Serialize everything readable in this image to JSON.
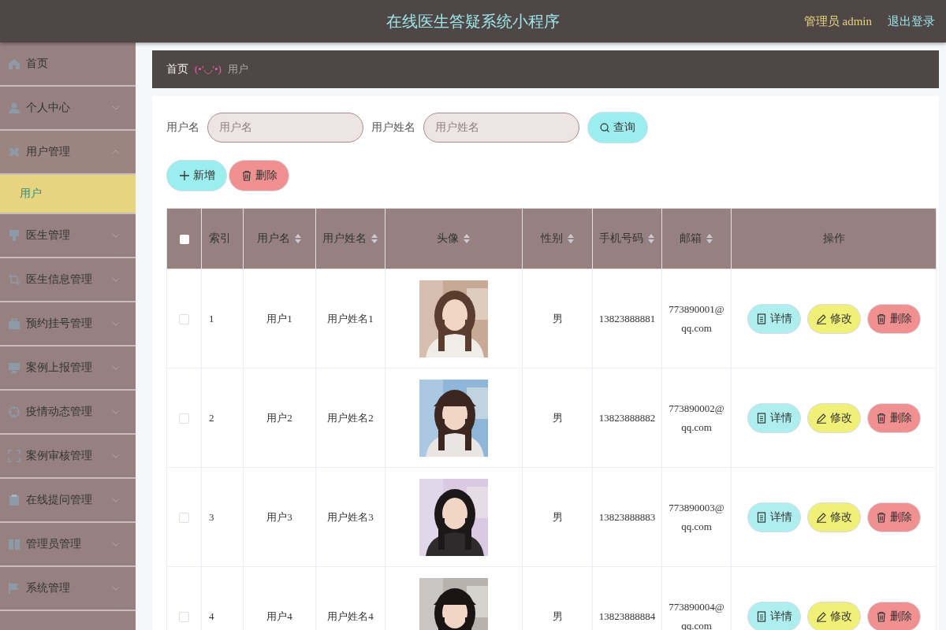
{
  "header": {
    "title": "在线医生答疑系统小程序",
    "user": "管理员 admin",
    "logout": "退出登录"
  },
  "sidebar": {
    "items": [
      {
        "label": "首页",
        "expandable": false,
        "selected": false
      },
      {
        "label": "个人中心",
        "expandable": true,
        "expanded": false,
        "selected": false
      },
      {
        "label": "用户管理",
        "expandable": true,
        "expanded": true,
        "selected": false,
        "children": [
          {
            "label": "用户",
            "selected": true
          }
        ]
      },
      {
        "label": "医生管理",
        "expandable": true,
        "expanded": false,
        "selected": false
      },
      {
        "label": "医生信息管理",
        "expandable": true,
        "expanded": false,
        "selected": false
      },
      {
        "label": "预约挂号管理",
        "expandable": true,
        "expanded": false,
        "selected": false
      },
      {
        "label": "案例上报管理",
        "expandable": true,
        "expanded": false,
        "selected": false
      },
      {
        "label": "疫情动态管理",
        "expandable": true,
        "expanded": false,
        "selected": false
      },
      {
        "label": "案例审核管理",
        "expandable": true,
        "expanded": false,
        "selected": false
      },
      {
        "label": "在线提问管理",
        "expandable": true,
        "expanded": false,
        "selected": false
      },
      {
        "label": "管理员管理",
        "expandable": true,
        "expanded": false,
        "selected": false
      },
      {
        "label": "系统管理",
        "expandable": true,
        "expanded": false,
        "selected": false
      }
    ]
  },
  "breadcrumb": {
    "home": "首页",
    "separator": "(•'◡'•)",
    "current": "用户"
  },
  "search": {
    "fields": [
      {
        "label": "用户名",
        "placeholder": "用户名"
      },
      {
        "label": "用户姓名",
        "placeholder": "用户姓名"
      }
    ],
    "button": "查询"
  },
  "actions": [
    {
      "kind": "add",
      "label": "新增"
    },
    {
      "kind": "delete",
      "label": "删除"
    }
  ],
  "table": {
    "select_all_checked": false,
    "columns": [
      {
        "label": "索引",
        "sortable": false
      },
      {
        "label": "用户名",
        "sortable": true
      },
      {
        "label": "用户姓名",
        "sortable": true
      },
      {
        "label": "头像",
        "sortable": true
      },
      {
        "label": "性别",
        "sortable": true
      },
      {
        "label": "手机号码",
        "sortable": true
      },
      {
        "label": "邮箱",
        "sortable": true
      },
      {
        "label": "操作",
        "sortable": false
      }
    ],
    "rows": [
      {
        "checked": false,
        "index": "1",
        "username": "用户1",
        "name": "用户姓名1",
        "avatar": {
          "kind": "picture"
        },
        "gender": "男",
        "phone": "13823888881",
        "email": "773890001@qq.com",
        "actions": [
          {
            "kind": "detail",
            "label": "详情"
          },
          {
            "kind": "edit",
            "label": "修改"
          },
          {
            "kind": "delete",
            "label": "删除"
          }
        ]
      },
      {
        "checked": false,
        "index": "2",
        "username": "用户2",
        "name": "用户姓名2",
        "avatar": {
          "kind": "picture"
        },
        "gender": "男",
        "phone": "13823888882",
        "email": "773890002@qq.com",
        "actions": [
          {
            "kind": "detail",
            "label": "详情"
          },
          {
            "kind": "edit",
            "label": "修改"
          },
          {
            "kind": "delete",
            "label": "删除"
          }
        ]
      },
      {
        "checked": false,
        "index": "3",
        "username": "用户3",
        "name": "用户姓名3",
        "avatar": {
          "kind": "picture"
        },
        "gender": "男",
        "phone": "13823888883",
        "email": "773890003@qq.com",
        "actions": [
          {
            "kind": "detail",
            "label": "详情"
          },
          {
            "kind": "edit",
            "label": "修改"
          },
          {
            "kind": "delete",
            "label": "删除"
          }
        ]
      },
      {
        "checked": false,
        "index": "4",
        "username": "用户4",
        "name": "用户姓名4",
        "avatar": {
          "kind": "picture"
        },
        "gender": "男",
        "phone": "13823888884",
        "email": "773890004@qq.com",
        "actions": [
          {
            "kind": "detail",
            "label": "详情"
          },
          {
            "kind": "edit",
            "label": "修改"
          },
          {
            "kind": "delete",
            "label": "删除"
          }
        ]
      }
    ]
  }
}
